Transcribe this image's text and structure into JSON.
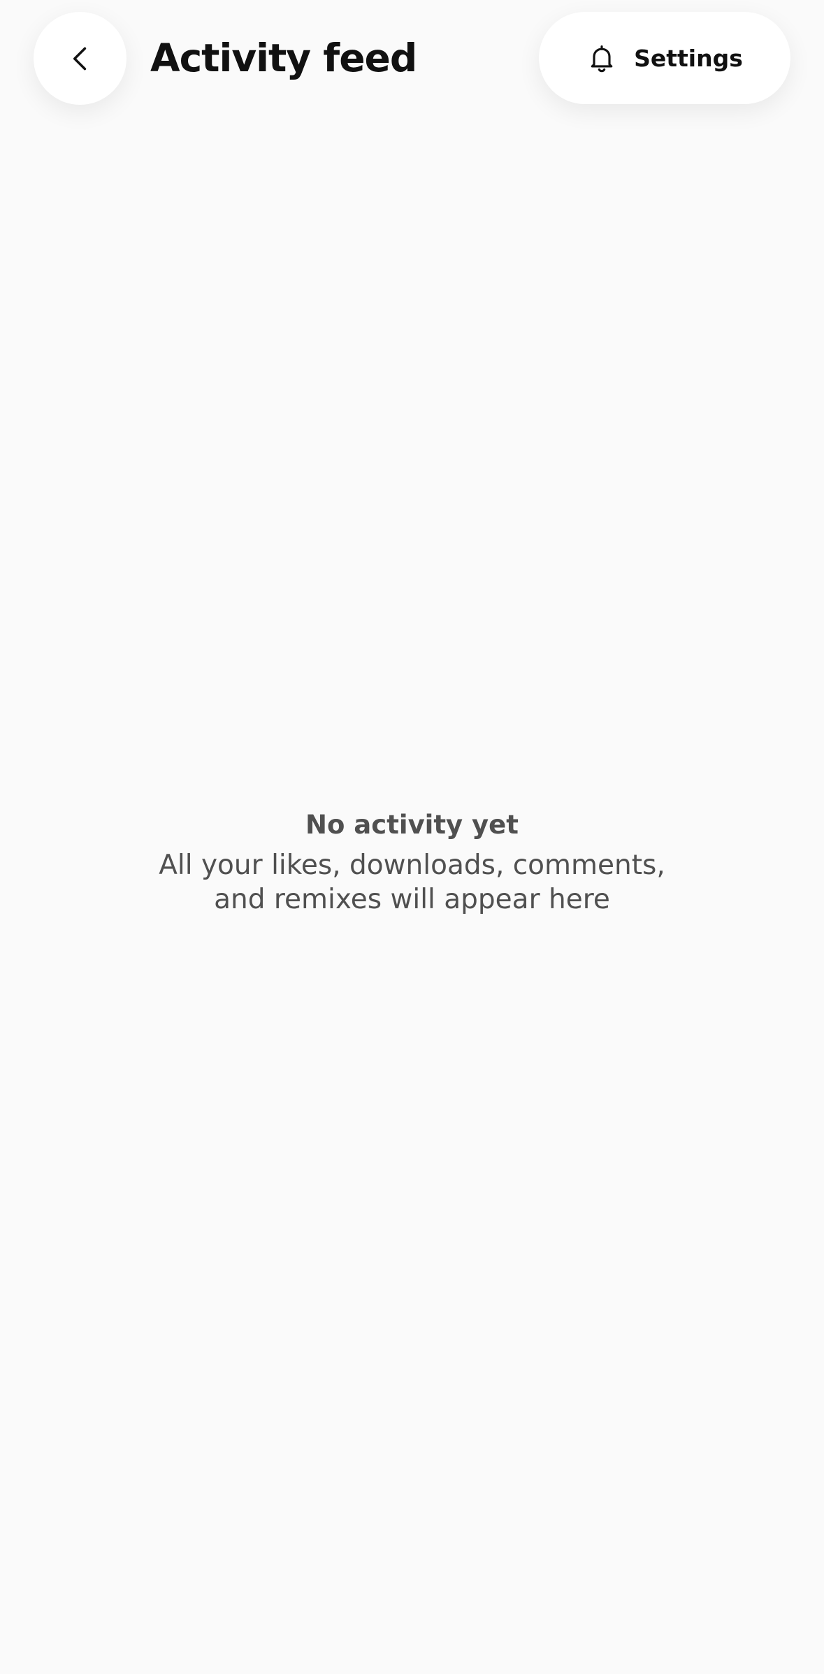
{
  "header": {
    "back_icon": "chevron-left-icon",
    "title": "Activity feed",
    "settings": {
      "icon": "bell-icon",
      "label": "Settings"
    }
  },
  "empty_state": {
    "title": "No activity yet",
    "description": "All your likes, downloads, comments, and remixes will appear here"
  },
  "colors": {
    "background": "#fafafa",
    "surface": "#ffffff",
    "title_text": "#111111",
    "muted_text": "#505050"
  }
}
